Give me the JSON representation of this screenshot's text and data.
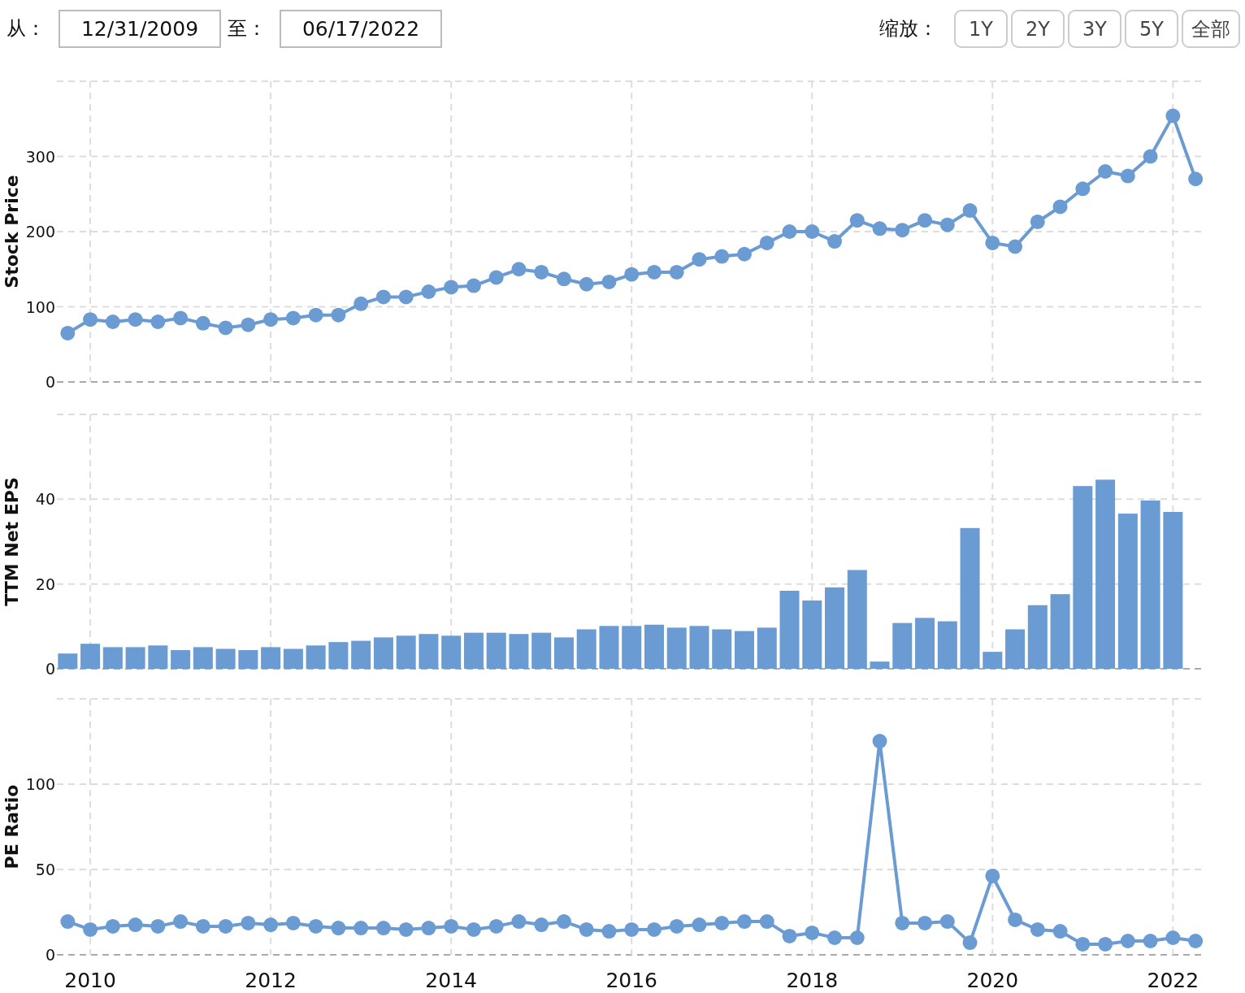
{
  "range": {
    "from_label": "从：",
    "from": "12/31/2009",
    "to_label": "至：",
    "to": "06/17/2022"
  },
  "zoom": {
    "label": "缩放：",
    "buttons": [
      {
        "label": "1Y",
        "selected": false
      },
      {
        "label": "2Y",
        "selected": false
      },
      {
        "label": "3Y",
        "selected": false
      },
      {
        "label": "5Y",
        "selected": false
      },
      {
        "label": "全部",
        "selected": false
      }
    ]
  },
  "panels": [
    {
      "chart_data": {
        "type": "line",
        "grid": true,
        "ylabel": "Stock Price",
        "xlim": [
          2009.63,
          2022.33
        ],
        "ylim": [
          0,
          400
        ],
        "yticks": [
          0,
          100,
          200,
          300
        ],
        "x": [
          2009.75,
          2010,
          2010.25,
          2010.5,
          2010.75,
          2011,
          2011.25,
          2011.5,
          2011.75,
          2012,
          2012.25,
          2012.5,
          2012.75,
          2013,
          2013.25,
          2013.5,
          2013.75,
          2014,
          2014.25,
          2014.5,
          2014.75,
          2015,
          2015.25,
          2015.5,
          2015.75,
          2016,
          2016.25,
          2016.5,
          2016.75,
          2017,
          2017.25,
          2017.5,
          2017.75,
          2018,
          2018.25,
          2018.5,
          2018.75,
          2019,
          2019.25,
          2019.5,
          2019.75,
          2020,
          2020.25,
          2020.5,
          2020.75,
          2021,
          2021.25,
          2021.5,
          2021.75,
          2022,
          2022.25
        ],
        "series": [
          {
            "color": "#6a9bd2",
            "marker": "circle",
            "values": [
              65,
              83,
              80,
              83,
              80,
              85,
              78,
              72,
              76,
              83,
              85,
              89,
              89,
              104,
              113,
              113,
              120,
              126,
              128,
              139,
              150,
              146,
              137,
              130,
              133,
              143,
              146,
              146,
              163,
              167,
              170,
              185,
              200,
              200,
              187,
              215,
              204,
              202,
              215,
              209,
              228,
              185,
              180,
              213,
              233,
              257,
              280,
              274,
              300,
              354,
              270
            ]
          }
        ]
      }
    },
    {
      "chart_data": {
        "type": "bar",
        "grid": true,
        "ylabel": "TTM Net EPS",
        "xlim": [
          2009.63,
          2022.33
        ],
        "ylim": [
          0,
          60
        ],
        "yticks": [
          0,
          20,
          40
        ],
        "x": [
          2009.75,
          2010,
          2010.25,
          2010.5,
          2010.75,
          2011,
          2011.25,
          2011.5,
          2011.75,
          2012,
          2012.25,
          2012.5,
          2012.75,
          2013,
          2013.25,
          2013.5,
          2013.75,
          2014,
          2014.25,
          2014.5,
          2014.75,
          2015,
          2015.25,
          2015.5,
          2015.75,
          2016,
          2016.25,
          2016.5,
          2016.75,
          2017,
          2017.25,
          2017.5,
          2017.75,
          2018,
          2018.25,
          2018.5,
          2018.75,
          2019,
          2019.25,
          2019.5,
          2019.75,
          2020,
          2020.25,
          2020.5,
          2020.75,
          2021,
          2021.25,
          2021.5,
          2021.75,
          2022
        ],
        "series": [
          {
            "color": "#6a9bd2",
            "values": [
              3.6,
              5.9,
              5.1,
              5.1,
              5.5,
              4.4,
              5.1,
              4.7,
              4.4,
              5.1,
              4.7,
              5.5,
              6.3,
              6.6,
              7.4,
              7.8,
              8.2,
              7.8,
              8.5,
              8.5,
              8.2,
              8.5,
              7.4,
              9.3,
              10.1,
              10.1,
              10.4,
              9.7,
              10.1,
              9.3,
              8.9,
              9.7,
              18.4,
              16.1,
              19.2,
              23.3,
              1.7,
              10.8,
              12.0,
              11.2,
              33.2,
              4.0,
              9.3,
              15.0,
              17.6,
              43.1,
              44.6,
              36.6,
              39.7,
              37.0
            ]
          }
        ]
      }
    },
    {
      "chart_data": {
        "type": "line",
        "grid": true,
        "ylabel": "PE Ratio",
        "xlim": [
          2009.63,
          2022.33
        ],
        "ylim": [
          0,
          150
        ],
        "xticks": [
          2010,
          2012,
          2014,
          2016,
          2018,
          2020,
          2022
        ],
        "yticks": [
          0,
          50,
          100
        ],
        "x": [
          2009.75,
          2010,
          2010.25,
          2010.5,
          2010.75,
          2011,
          2011.25,
          2011.5,
          2011.75,
          2012,
          2012.25,
          2012.5,
          2012.75,
          2013,
          2013.25,
          2013.5,
          2013.75,
          2014,
          2014.25,
          2014.5,
          2014.75,
          2015,
          2015.25,
          2015.5,
          2015.75,
          2016,
          2016.25,
          2016.5,
          2016.75,
          2017,
          2017.25,
          2017.5,
          2017.75,
          2018,
          2018.25,
          2018.5,
          2018.75,
          2019,
          2019.25,
          2019.5,
          2019.75,
          2020,
          2020.25,
          2020.5,
          2020.75,
          2021,
          2021.25,
          2021.5,
          2021.75,
          2022,
          2022.25
        ],
        "series": [
          {
            "color": "#6a9bd2",
            "marker": "circle",
            "values": [
              19.5,
              14.8,
              16.7,
              17.6,
              16.7,
              19.5,
              16.7,
              16.7,
              18.6,
              17.6,
              18.6,
              16.7,
              15.7,
              15.7,
              15.7,
              14.8,
              15.7,
              16.7,
              14.8,
              16.7,
              19.5,
              17.6,
              19.5,
              14.8,
              13.8,
              14.8,
              14.8,
              16.7,
              17.6,
              18.6,
              19.5,
              19.5,
              11.0,
              12.9,
              10.0,
              10.0,
              125.2,
              18.6,
              18.6,
              19.5,
              7.1,
              46.2,
              20.5,
              14.8,
              13.8,
              6.2,
              6.2,
              8.1,
              8.1,
              10.0,
              8.1
            ]
          }
        ]
      }
    }
  ]
}
